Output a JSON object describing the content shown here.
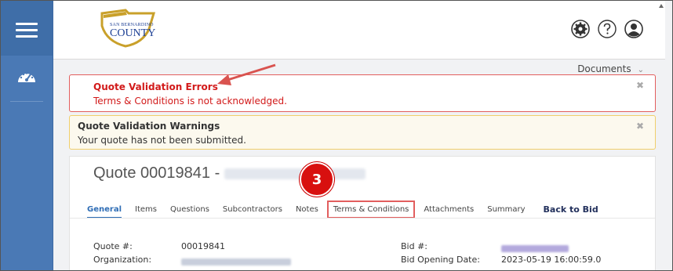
{
  "sidebar": {
    "menu_icon": "hamburger-icon",
    "dashboard_icon": "gauge-icon"
  },
  "header": {
    "logo_top": "SAN BERNARDINO",
    "logo_main": "COUNTY",
    "icons": [
      "gear-icon",
      "help-icon",
      "user-icon"
    ]
  },
  "documents": {
    "label": "Documents"
  },
  "errors": {
    "title": "Quote Validation Errors",
    "message": "Terms & Conditions is not acknowledged."
  },
  "warnings": {
    "title": "Quote Validation Warnings",
    "message": "Your quote has not been submitted."
  },
  "quote": {
    "title": "Quote 00019841 -"
  },
  "badge": {
    "number": "3"
  },
  "tabs": [
    {
      "label": "General"
    },
    {
      "label": "Items"
    },
    {
      "label": "Questions"
    },
    {
      "label": "Subcontractors"
    },
    {
      "label": "Notes"
    },
    {
      "label": "Terms & Conditions"
    },
    {
      "label": "Attachments"
    },
    {
      "label": "Summary"
    },
    {
      "label": "Back to Bid"
    }
  ],
  "fields": {
    "quote_no_label": "Quote #:",
    "quote_no_value": "00019841",
    "org_label": "Organization:",
    "bid_no_label": "Bid #:",
    "bid_open_label": "Bid Opening Date:",
    "bid_open_value": "2023-05-19 16:00:59.0"
  },
  "colors": {
    "error": "#d21a1a",
    "sidebar": "#4a79b5",
    "badge": "#d8100f",
    "tab_active": "#2f6db5"
  }
}
